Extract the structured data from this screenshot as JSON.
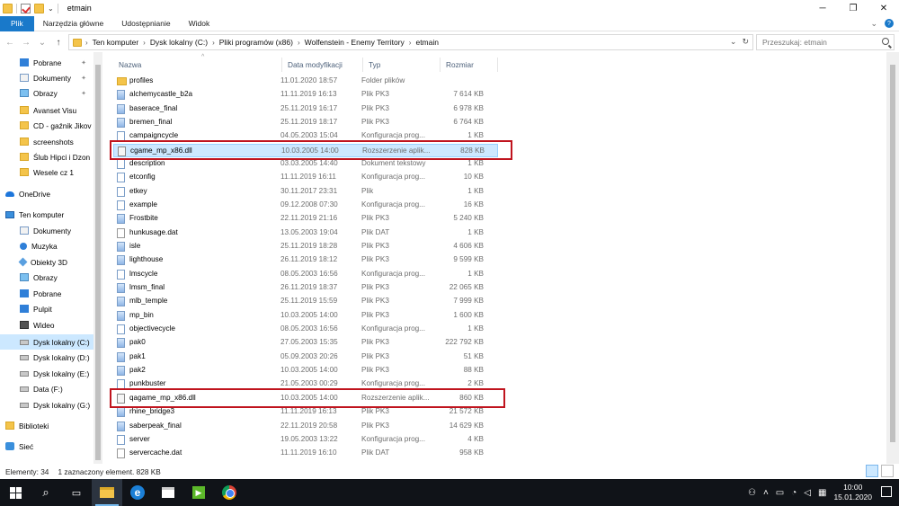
{
  "window": {
    "title": "etmain",
    "controls": {
      "minimize": "─",
      "maximize": "❐",
      "close": "✕"
    }
  },
  "ribbon": {
    "tabs": [
      "Plik",
      "Narzędzia główne",
      "Udostępnianie",
      "Widok"
    ],
    "chevron": "⌄",
    "help": "?"
  },
  "address": {
    "breadcrumbs": [
      "Ten komputer",
      "Dysk lokalny (C:)",
      "Pliki programów (x86)",
      "Wolfenstein - Enemy Territory",
      "etmain"
    ],
    "separator": "›",
    "search_placeholder": "Przeszukaj: etmain"
  },
  "sidebar": {
    "items": [
      {
        "label": "Pobrane",
        "icon": "download-icon",
        "pinned": true
      },
      {
        "label": "Dokumenty",
        "icon": "documents-icon",
        "pinned": true
      },
      {
        "label": "Obrazy",
        "icon": "pictures-icon",
        "pinned": true
      },
      {
        "label": "Avanset Visu",
        "icon": "folder-icon",
        "pinned": false
      },
      {
        "label": "CD - gaźnik Jikov",
        "icon": "folder-icon",
        "pinned": false
      },
      {
        "label": "screenshots",
        "icon": "folder-icon",
        "pinned": false
      },
      {
        "label": "Ślub Hipci i Dzon",
        "icon": "folder-icon",
        "pinned": false
      },
      {
        "label": "Wesele cz 1",
        "icon": "folder-icon",
        "pinned": false
      },
      {
        "label": "OneDrive",
        "icon": "onedrive-icon",
        "pinned": false
      },
      {
        "label": "Ten komputer",
        "icon": "computer-icon",
        "pinned": false
      },
      {
        "label": "Dokumenty",
        "icon": "documents-icon",
        "pinned": false
      },
      {
        "label": "Muzyka",
        "icon": "music-icon",
        "pinned": false
      },
      {
        "label": "Obiekty 3D",
        "icon": "objects-3d-icon",
        "pinned": false
      },
      {
        "label": "Obrazy",
        "icon": "pictures-icon",
        "pinned": false
      },
      {
        "label": "Pobrane",
        "icon": "download-icon",
        "pinned": false
      },
      {
        "label": "Pulpit",
        "icon": "desktop-icon",
        "pinned": false
      },
      {
        "label": "Wideo",
        "icon": "video-icon",
        "pinned": false
      },
      {
        "label": "Dysk lokalny (C:)",
        "icon": "drive-icon",
        "pinned": false,
        "selected": true
      },
      {
        "label": "Dysk lokalny (D:)",
        "icon": "drive-icon",
        "pinned": false
      },
      {
        "label": "Dysk lokalny (E:)",
        "icon": "drive-icon",
        "pinned": false
      },
      {
        "label": "Data (F:)",
        "icon": "drive-icon",
        "pinned": false
      },
      {
        "label": "Dysk lokalny (G:)",
        "icon": "drive-icon",
        "pinned": false
      },
      {
        "label": "Biblioteki",
        "icon": "library-icon",
        "pinned": false
      },
      {
        "label": "Sieć",
        "icon": "network-icon",
        "pinned": false
      }
    ]
  },
  "columns": [
    "Nazwa",
    "Data modyfikacji",
    "Typ",
    "Rozmiar"
  ],
  "files": [
    {
      "name": "profiles",
      "date": "11.01.2020 18:57",
      "type": "Folder plików",
      "size": "",
      "kind": "folder"
    },
    {
      "name": "alchemycastle_b2a",
      "date": "11.11.2019 16:13",
      "type": "Plik PK3",
      "size": "7 614 KB",
      "kind": "pk3"
    },
    {
      "name": "baserace_final",
      "date": "25.11.2019 16:17",
      "type": "Plik PK3",
      "size": "6 978 KB",
      "kind": "pk3"
    },
    {
      "name": "bremen_final",
      "date": "25.11.2019 18:17",
      "type": "Plik PK3",
      "size": "6 764 KB",
      "kind": "pk3"
    },
    {
      "name": "campaigncycle",
      "date": "04.05.2003 15:04",
      "type": "Konfiguracja prog...",
      "size": "1 KB",
      "kind": "cfg"
    },
    {
      "name": "cgame_mp_x86.dll",
      "date": "10.03.2005 14:00",
      "type": "Rozszerzenie aplik...",
      "size": "828 KB",
      "kind": "dll",
      "selected": true
    },
    {
      "name": "description",
      "date": "03.03.2005 14:40",
      "type": "Dokument tekstowy",
      "size": "1 KB",
      "kind": "txt"
    },
    {
      "name": "etconfig",
      "date": "11.11.2019 16:11",
      "type": "Konfiguracja prog...",
      "size": "10 KB",
      "kind": "cfg"
    },
    {
      "name": "etkey",
      "date": "30.11.2017 23:31",
      "type": "Plik",
      "size": "1 KB",
      "kind": "file"
    },
    {
      "name": "example",
      "date": "09.12.2008 07:30",
      "type": "Konfiguracja prog...",
      "size": "16 KB",
      "kind": "cfg"
    },
    {
      "name": "Frostbite",
      "date": "22.11.2019 21:16",
      "type": "Plik PK3",
      "size": "5 240 KB",
      "kind": "pk3"
    },
    {
      "name": "hunkusage.dat",
      "date": "13.05.2003 19:04",
      "type": "Plik DAT",
      "size": "1 KB",
      "kind": "dat"
    },
    {
      "name": "isle",
      "date": "25.11.2019 18:28",
      "type": "Plik PK3",
      "size": "4 606 KB",
      "kind": "pk3"
    },
    {
      "name": "lighthouse",
      "date": "26.11.2019 18:12",
      "type": "Plik PK3",
      "size": "9 599 KB",
      "kind": "pk3"
    },
    {
      "name": "lmscycle",
      "date": "08.05.2003 16:56",
      "type": "Konfiguracja prog...",
      "size": "1 KB",
      "kind": "cfg"
    },
    {
      "name": "lmsm_final",
      "date": "26.11.2019 18:37",
      "type": "Plik PK3",
      "size": "22 065 KB",
      "kind": "pk3"
    },
    {
      "name": "mlb_temple",
      "date": "25.11.2019 15:59",
      "type": "Plik PK3",
      "size": "7 999 KB",
      "kind": "pk3"
    },
    {
      "name": "mp_bin",
      "date": "10.03.2005 14:00",
      "type": "Plik PK3",
      "size": "1 600 KB",
      "kind": "pk3"
    },
    {
      "name": "objectivecycle",
      "date": "08.05.2003 16:56",
      "type": "Konfiguracja prog...",
      "size": "1 KB",
      "kind": "cfg"
    },
    {
      "name": "pak0",
      "date": "27.05.2003 15:35",
      "type": "Plik PK3",
      "size": "222 792 KB",
      "kind": "pk3"
    },
    {
      "name": "pak1",
      "date": "05.09.2003 20:26",
      "type": "Plik PK3",
      "size": "51 KB",
      "kind": "pk3"
    },
    {
      "name": "pak2",
      "date": "10.03.2005 14:00",
      "type": "Plik PK3",
      "size": "88 KB",
      "kind": "pk3"
    },
    {
      "name": "punkbuster",
      "date": "21.05.2003 00:29",
      "type": "Konfiguracja prog...",
      "size": "2 KB",
      "kind": "cfg"
    },
    {
      "name": "qagame_mp_x86.dll",
      "date": "10.03.2005 14:00",
      "type": "Rozszerzenie aplik...",
      "size": "860 KB",
      "kind": "dll"
    },
    {
      "name": "rhine_bridge3",
      "date": "11.11.2019 16:13",
      "type": "Plik PK3",
      "size": "21 572 KB",
      "kind": "pk3"
    },
    {
      "name": "saberpeak_final",
      "date": "22.11.2019 20:58",
      "type": "Plik PK3",
      "size": "14 629 KB",
      "kind": "pk3"
    },
    {
      "name": "server",
      "date": "19.05.2003 13:22",
      "type": "Konfiguracja prog...",
      "size": "4 KB",
      "kind": "cfg"
    },
    {
      "name": "servercache.dat",
      "date": "11.11.2019 16:10",
      "type": "Plik DAT",
      "size": "958 KB",
      "kind": "dat"
    }
  ],
  "status": {
    "count": "Elementy: 34",
    "selection": "1 zaznaczony element. 828 KB"
  },
  "taskbar": {
    "time": "10:00",
    "date": "15.01.2020"
  }
}
